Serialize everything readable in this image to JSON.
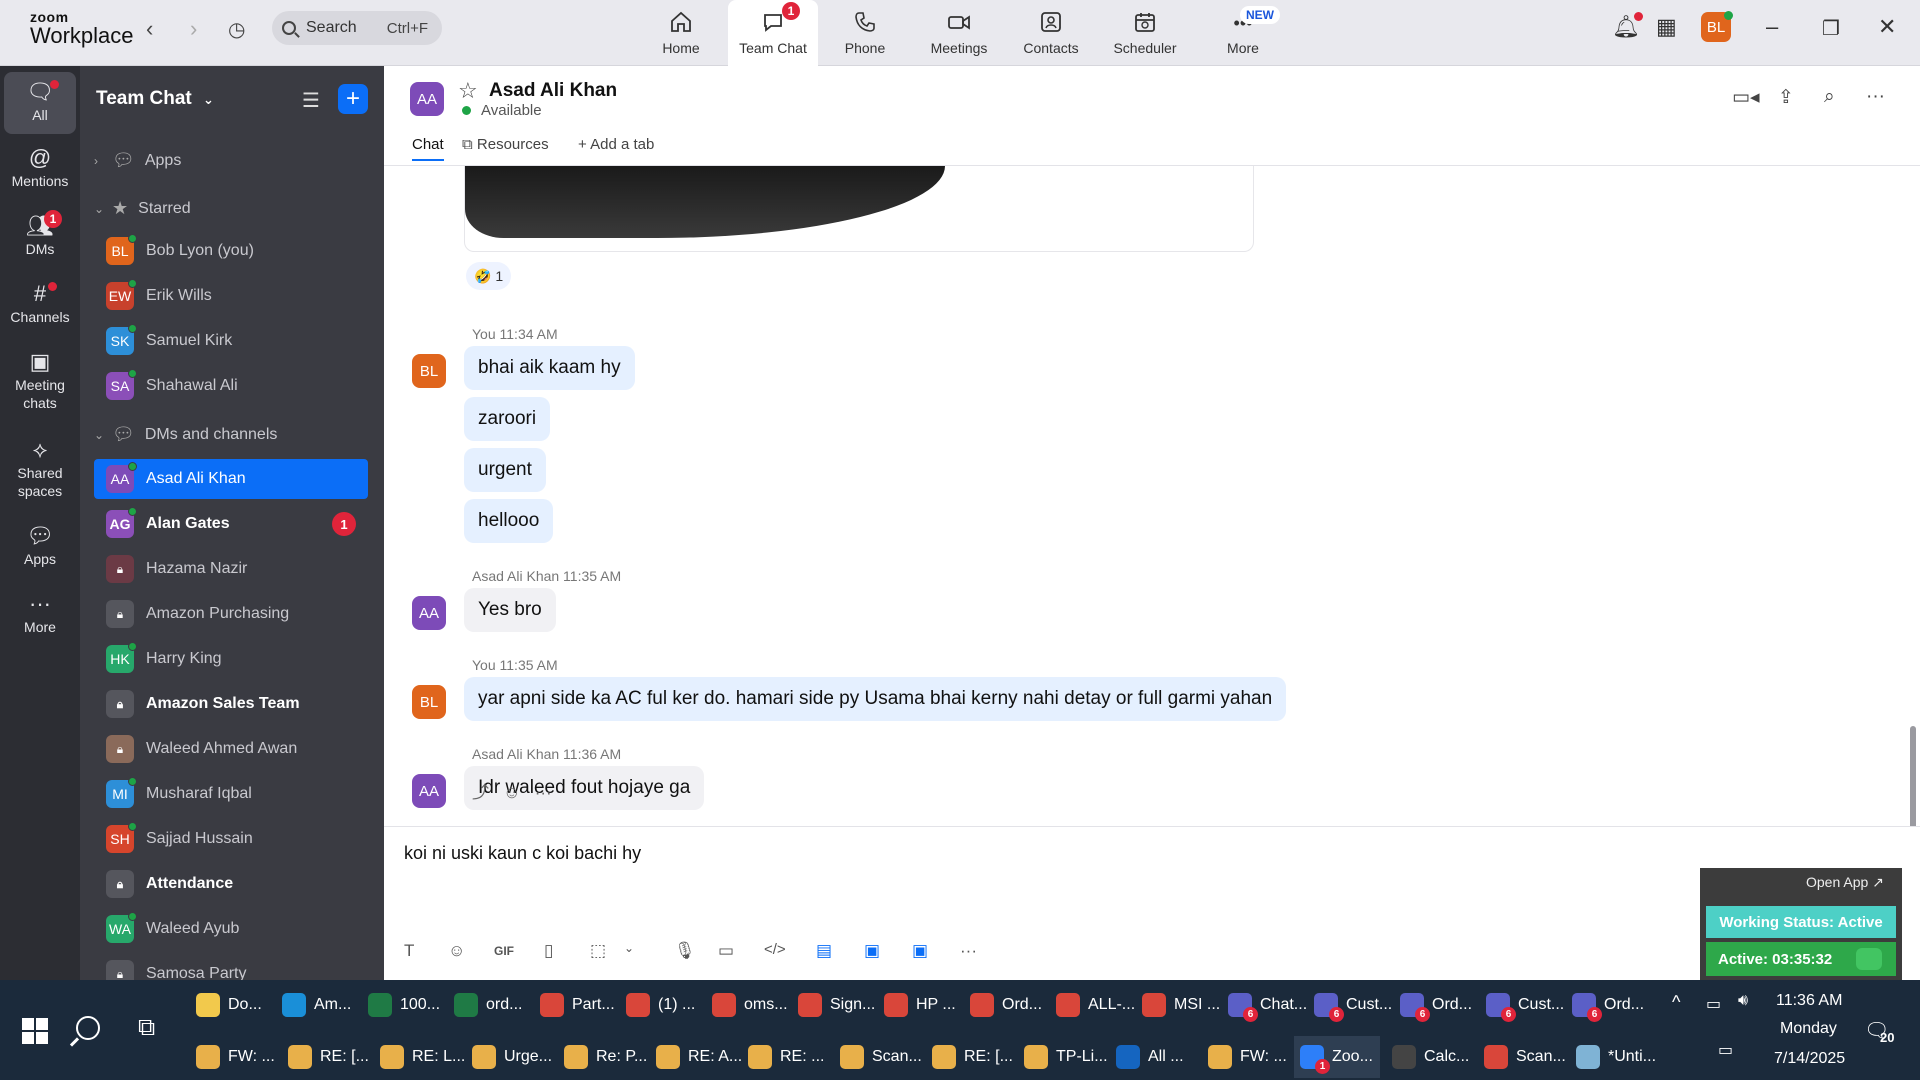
{
  "topbar": {
    "logo_line1": "zoom",
    "logo_line2": "Workplace",
    "search_label": "Search",
    "search_shortcut": "Ctrl+F",
    "tabs": [
      {
        "label": "Home"
      },
      {
        "label": "Team Chat",
        "badge": "1"
      },
      {
        "label": "Phone"
      },
      {
        "label": "Meetings"
      },
      {
        "label": "Contacts"
      },
      {
        "label": "Scheduler"
      },
      {
        "label": "More"
      }
    ],
    "new_badge": "NEW",
    "user_initials": "BL"
  },
  "rail": [
    {
      "label": "All"
    },
    {
      "label": "Mentions"
    },
    {
      "label": "DMs",
      "badge": "1"
    },
    {
      "label": "Channels"
    },
    {
      "label": "Meeting chats"
    },
    {
      "label": "Shared spaces"
    },
    {
      "label": "Apps"
    },
    {
      "label": "More"
    }
  ],
  "sidebar": {
    "title": "Team Chat",
    "sections": {
      "apps": "Apps",
      "starred": "Starred",
      "dms": "DMs and channels"
    },
    "starred": [
      {
        "name": "Bob Lyon (you)",
        "initials": "BL",
        "color": "#e0651c"
      },
      {
        "name": "Erik Wills",
        "initials": "EW",
        "color": "#c8412c"
      },
      {
        "name": "Samuel Kirk",
        "initials": "SK",
        "color": "#2d8fd8"
      },
      {
        "name": "Shahawal Ali",
        "initials": "SA",
        "color": "#8b4fb8"
      }
    ],
    "dms": [
      {
        "name": "Asad Ali Khan",
        "initials": "AA",
        "color": "#7d4bb8"
      },
      {
        "name": "Alan Gates",
        "initials": "AG",
        "color": "#8b4fb8",
        "unread": "1"
      },
      {
        "name": "Hazama Nazir",
        "initials": "",
        "color": "#6b3a45"
      },
      {
        "name": "Amazon Purchasing",
        "initials": "",
        "color": "#55565d"
      },
      {
        "name": "Harry King",
        "initials": "HK",
        "color": "#27a86b"
      },
      {
        "name": "Amazon Sales Team",
        "initials": "",
        "color": "#55565d"
      },
      {
        "name": "Waleed Ahmed Awan",
        "initials": "",
        "color": "#8a6a5a"
      },
      {
        "name": "Musharaf Iqbal",
        "initials": "MI",
        "color": "#2d8fd8"
      },
      {
        "name": "Sajjad Hussain",
        "initials": "SH",
        "color": "#d6452c"
      },
      {
        "name": "Attendance",
        "initials": "",
        "color": "#55565d"
      },
      {
        "name": "Waleed Ayub",
        "initials": "WA",
        "color": "#27a86b"
      },
      {
        "name": "Samosa Party",
        "initials": "",
        "color": "#55565d"
      }
    ]
  },
  "chat": {
    "contact_name": "Asad Ali Khan",
    "contact_initials": "AA",
    "status": "Available",
    "tabs": {
      "chat": "Chat",
      "resources": "Resources",
      "add": "Add a tab"
    },
    "reaction": "🤣 1",
    "groups": [
      {
        "meta": "You 11:34 AM",
        "initials": "BL",
        "mine": true,
        "messages": [
          "bhai aik kaam hy",
          "zaroori",
          "urgent",
          "hellooo"
        ]
      },
      {
        "meta": "Asad Ali Khan 11:35 AM",
        "initials": "AA",
        "mine": false,
        "messages": [
          "Yes bro"
        ]
      },
      {
        "meta": "You 11:35 AM",
        "initials": "BL",
        "mine": true,
        "messages": [
          "yar apni side ka AC ful ker do. hamari side py Usama bhai kerny nahi detay or full garmi yahan"
        ]
      },
      {
        "meta": "Asad Ali Khan 11:36 AM",
        "initials": "AA",
        "mine": false,
        "messages": [
          "Idr waleed fout hojaye ga"
        ]
      }
    ],
    "draft": "koi ni uski kaun c koi bachi hy"
  },
  "popup": {
    "open_app": "Open App ↗",
    "working_status": "Working Status: Active",
    "active_timer": "Active: 03:35:32"
  },
  "taskbar": {
    "row1": [
      {
        "label": "Do...",
        "color": "#f2c94c"
      },
      {
        "label": "Am...",
        "color": "#1a8fd8"
      },
      {
        "label": "100...",
        "color": "#1f7a45"
      },
      {
        "label": "ord...",
        "color": "#1f7a45"
      },
      {
        "label": "Part...",
        "color": "#d9463a"
      },
      {
        "label": "(1) ...",
        "color": "#d9463a"
      },
      {
        "label": "oms...",
        "color": "#d9463a"
      },
      {
        "label": "Sign...",
        "color": "#d9463a"
      },
      {
        "label": "HP ...",
        "color": "#d9463a"
      },
      {
        "label": "Ord...",
        "color": "#d9463a"
      },
      {
        "label": "ALL-...",
        "color": "#d9463a"
      },
      {
        "label": "MSI ...",
        "color": "#d9463a"
      },
      {
        "label": "Chat...",
        "color": "#5b5fc7",
        "badge": "6"
      },
      {
        "label": "Cust...",
        "color": "#5b5fc7",
        "badge": "6"
      },
      {
        "label": "Ord...",
        "color": "#5b5fc7",
        "badge": "6"
      },
      {
        "label": "Cust...",
        "color": "#5b5fc7",
        "badge": "6"
      },
      {
        "label": "Ord...",
        "color": "#5b5fc7",
        "badge": "6"
      }
    ],
    "row2": [
      {
        "label": "FW: ...",
        "color": "#e8b04a"
      },
      {
        "label": "RE: [...",
        "color": "#e8b04a"
      },
      {
        "label": "RE: L...",
        "color": "#e8b04a"
      },
      {
        "label": "Urge...",
        "color": "#e8b04a"
      },
      {
        "label": "Re: P...",
        "color": "#e8b04a"
      },
      {
        "label": "RE: A...",
        "color": "#e8b04a"
      },
      {
        "label": "RE: ...",
        "color": "#e8b04a"
      },
      {
        "label": "Scan...",
        "color": "#e8b04a"
      },
      {
        "label": "RE: [...",
        "color": "#e8b04a"
      },
      {
        "label": "TP-Li...",
        "color": "#e8b04a"
      },
      {
        "label": "All ...",
        "color": "#1565c0"
      },
      {
        "label": "FW: ...",
        "color": "#e8b04a"
      },
      {
        "label": "Zoo...",
        "color": "#2d7ff9",
        "badge": "1"
      },
      {
        "label": "Calc...",
        "color": "#444"
      },
      {
        "label": "Scan...",
        "color": "#d9463a"
      },
      {
        "label": "*Unti...",
        "color": "#7fb3d5"
      }
    ],
    "time": "11:36 AM",
    "day": "Monday",
    "date": "7/14/2025",
    "notifications": "20"
  }
}
